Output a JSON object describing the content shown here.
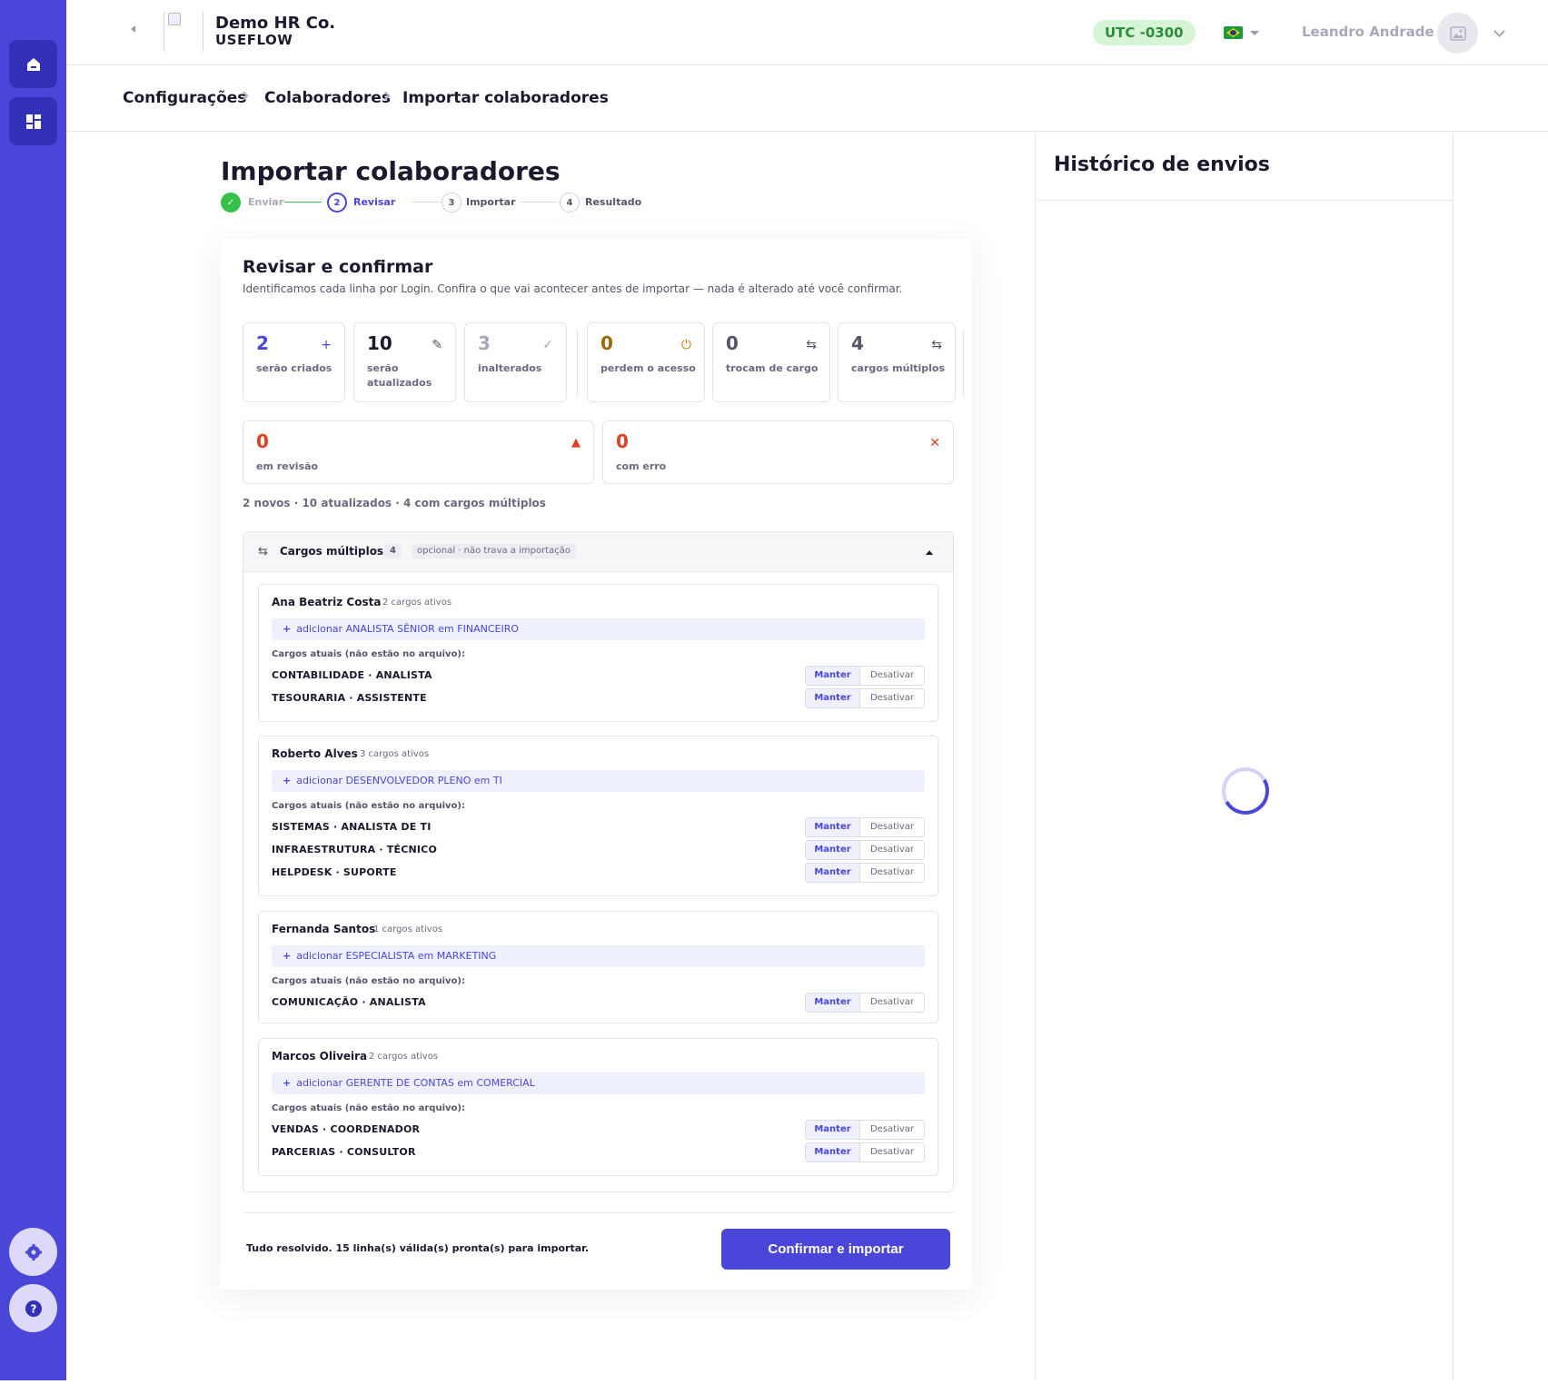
{
  "sidebar": {
    "top_icons": [
      "home-icon",
      "dashboard-icon"
    ],
    "bottom_icons": [
      "settings-icon",
      "help-icon"
    ]
  },
  "header": {
    "company_name": "Demo HR Co.",
    "company_sub": "USEFLOW",
    "timezone": "UTC -0300",
    "language_flag": "brazil-flag-icon",
    "user_name": "Leandro Andrade"
  },
  "breadcrumb": [
    "Configurações",
    "Colaboradores",
    "Importar colaboradores"
  ],
  "page": {
    "title": "Importar colaboradores",
    "steps": [
      {
        "num": "✓",
        "label": "Enviar",
        "state": "done"
      },
      {
        "num": "2",
        "label": "Revisar",
        "state": "active"
      },
      {
        "num": "3",
        "label": "Importar",
        "state": "pending"
      },
      {
        "num": "4",
        "label": "Resultado",
        "state": "pending"
      }
    ]
  },
  "review": {
    "title": "Revisar e confirmar",
    "subtitle": "Identificamos cada linha por Login. Confira o que vai acontecer antes de importar — nada é alterado até você confirmar.",
    "stats": [
      {
        "value": "2",
        "label": "serão criados",
        "icon": "+",
        "color": "#4a46d9"
      },
      {
        "value": "10",
        "label": "serão atualizados",
        "icon": "✎",
        "color": "#1a1a2e"
      },
      {
        "value": "3",
        "label": "inalterados",
        "icon": "✓",
        "color": "#a8a8b8"
      },
      {
        "value": "0",
        "label": "perdem o acesso",
        "icon": "⏻",
        "color": "#9a6a00"
      },
      {
        "value": "0",
        "label": "trocam de cargo",
        "icon": "⇆",
        "color": "#55556a"
      },
      {
        "value": "4",
        "label": "cargos múltiplos",
        "icon": "⇆",
        "color": "#55556a"
      }
    ],
    "alerts": [
      {
        "value": "0",
        "label": "em revisão",
        "icon": "▲",
        "color": "#e0401f"
      },
      {
        "value": "0",
        "label": "com erro",
        "icon": "✕",
        "color": "#e0401f"
      }
    ],
    "summary": "2 novos · 10 atualizados · 4 com cargos múltiplos",
    "section": {
      "title": "Cargos múltiplos",
      "count": "4",
      "note": "opcional · não trava a importação",
      "current_label": "Cargos atuais (não estão no arquivo):",
      "keep_label": "Manter",
      "deactivate_label": "Desativar",
      "people": [
        {
          "name": "Ana Beatriz Costa",
          "count": "2 cargos ativos",
          "add": "adicionar ANALISTA SÊNIOR em FINANCEIRO",
          "roles": [
            "CONTABILIDADE · ANALISTA",
            "TESOURARIA · ASSISTENTE"
          ]
        },
        {
          "name": "Roberto Alves",
          "count": "3 cargos ativos",
          "add": "adicionar DESENVOLVEDOR PLENO em TI",
          "roles": [
            "SISTEMAS · ANALISTA DE TI",
            "INFRAESTRUTURA · TÉCNICO",
            "HELPDESK · SUPORTE"
          ]
        },
        {
          "name": "Fernanda Santos",
          "count": "1 cargos ativos",
          "add": "adicionar ESPECIALISTA em MARKETING",
          "roles": [
            "COMUNICAÇÃO · ANALISTA"
          ]
        },
        {
          "name": "Marcos Oliveira",
          "count": "2 cargos ativos",
          "add": "adicionar GERENTE DE CONTAS em COMERCIAL",
          "roles": [
            "VENDAS · COORDENADOR",
            "PARCERIAS · CONSULTOR"
          ]
        }
      ]
    },
    "footer_text": "Tudo resolvido. 15 linha(s) válida(s) pronta(s) para importar.",
    "confirm_label": "Confirmar e importar"
  },
  "history": {
    "title": "Histórico de envios"
  }
}
